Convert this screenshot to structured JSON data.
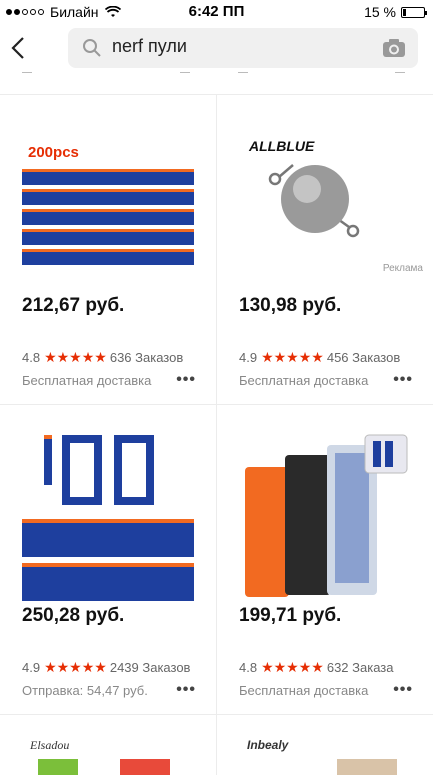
{
  "status": {
    "carrier": "Билайн",
    "time": "6:42 ПП",
    "battery": "15 %",
    "battery_level": 0.15
  },
  "search": {
    "query": "nerf пули"
  },
  "products": [
    {
      "price": "212,67 руб.",
      "rating": "4.8",
      "orders": "636 Заказов",
      "shipping": "Бесплатная доставка",
      "image_label": "200pcs"
    },
    {
      "price": "130,98 руб.",
      "rating": "4.9",
      "orders": "456 Заказов",
      "shipping": "Бесплатная доставка",
      "brand": "ALLBLUE",
      "ad": "Реклама"
    },
    {
      "price": "250,28 руб.",
      "rating": "4.9",
      "orders": "2439 Заказов",
      "shipping": "Отправка: 54,47 руб."
    },
    {
      "price": "199,71 руб.",
      "rating": "4.8",
      "orders": "632 Заказа",
      "shipping": "Бесплатная доставка"
    }
  ],
  "partial": [
    {
      "brand": "Elsadou"
    },
    {
      "brand": "Inbealy"
    }
  ],
  "colors": {
    "accent": "#e62e04",
    "dart_blue": "#1e3f9e",
    "dart_orange": "#f26a21"
  }
}
